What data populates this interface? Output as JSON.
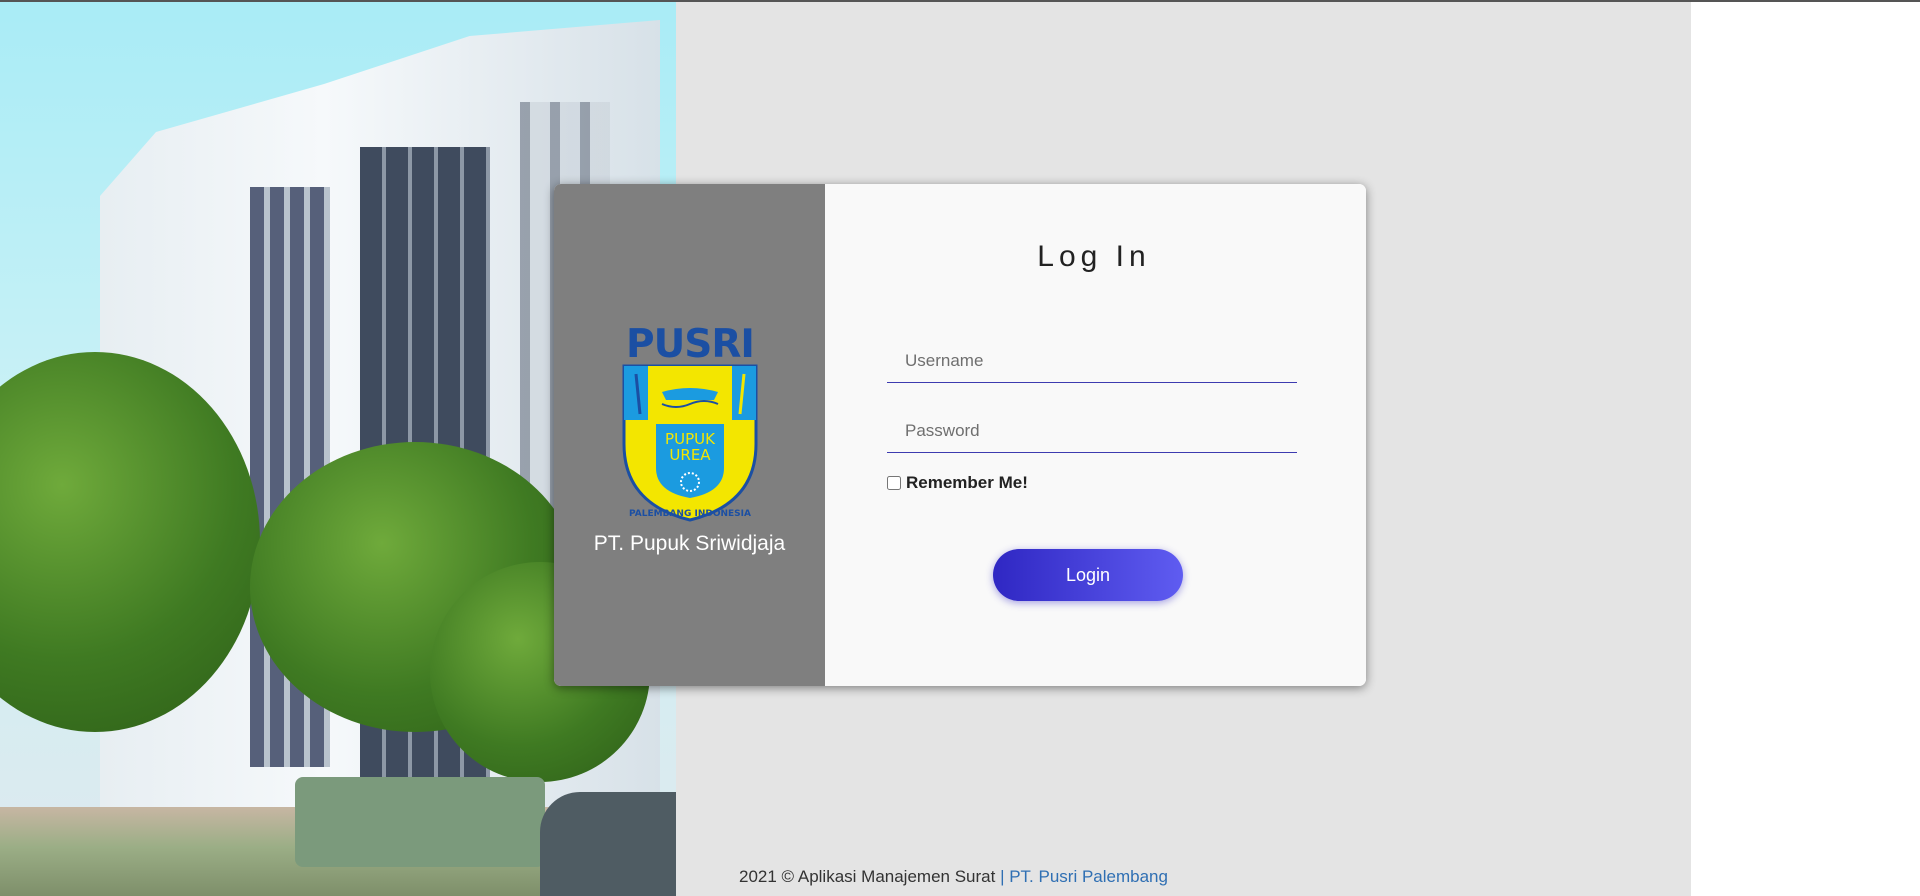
{
  "brand": {
    "logo_text": "PUSRI",
    "emblem_center_line1": "PUPUK",
    "emblem_center_line2": "UREA",
    "emblem_ring_text": "PALEMBANG INDONESIA",
    "company_name": "PT. Pupuk Sriwidjaja"
  },
  "login": {
    "title": "Log In",
    "username_placeholder": "Username",
    "password_placeholder": "Password",
    "remember_label": "Remember Me!",
    "remember_checked": false,
    "button_label": "Login"
  },
  "footer": {
    "text": "2021 © Aplikasi Manajemen Surat",
    "link_text": "| PT. Pusri Palembang"
  },
  "colors": {
    "accent_start": "#2f27c3",
    "accent_end": "#5f5cf1",
    "panel_gray": "#7f7f7f",
    "logo_blue": "#1b4fa3",
    "logo_yellow": "#f3e600"
  }
}
